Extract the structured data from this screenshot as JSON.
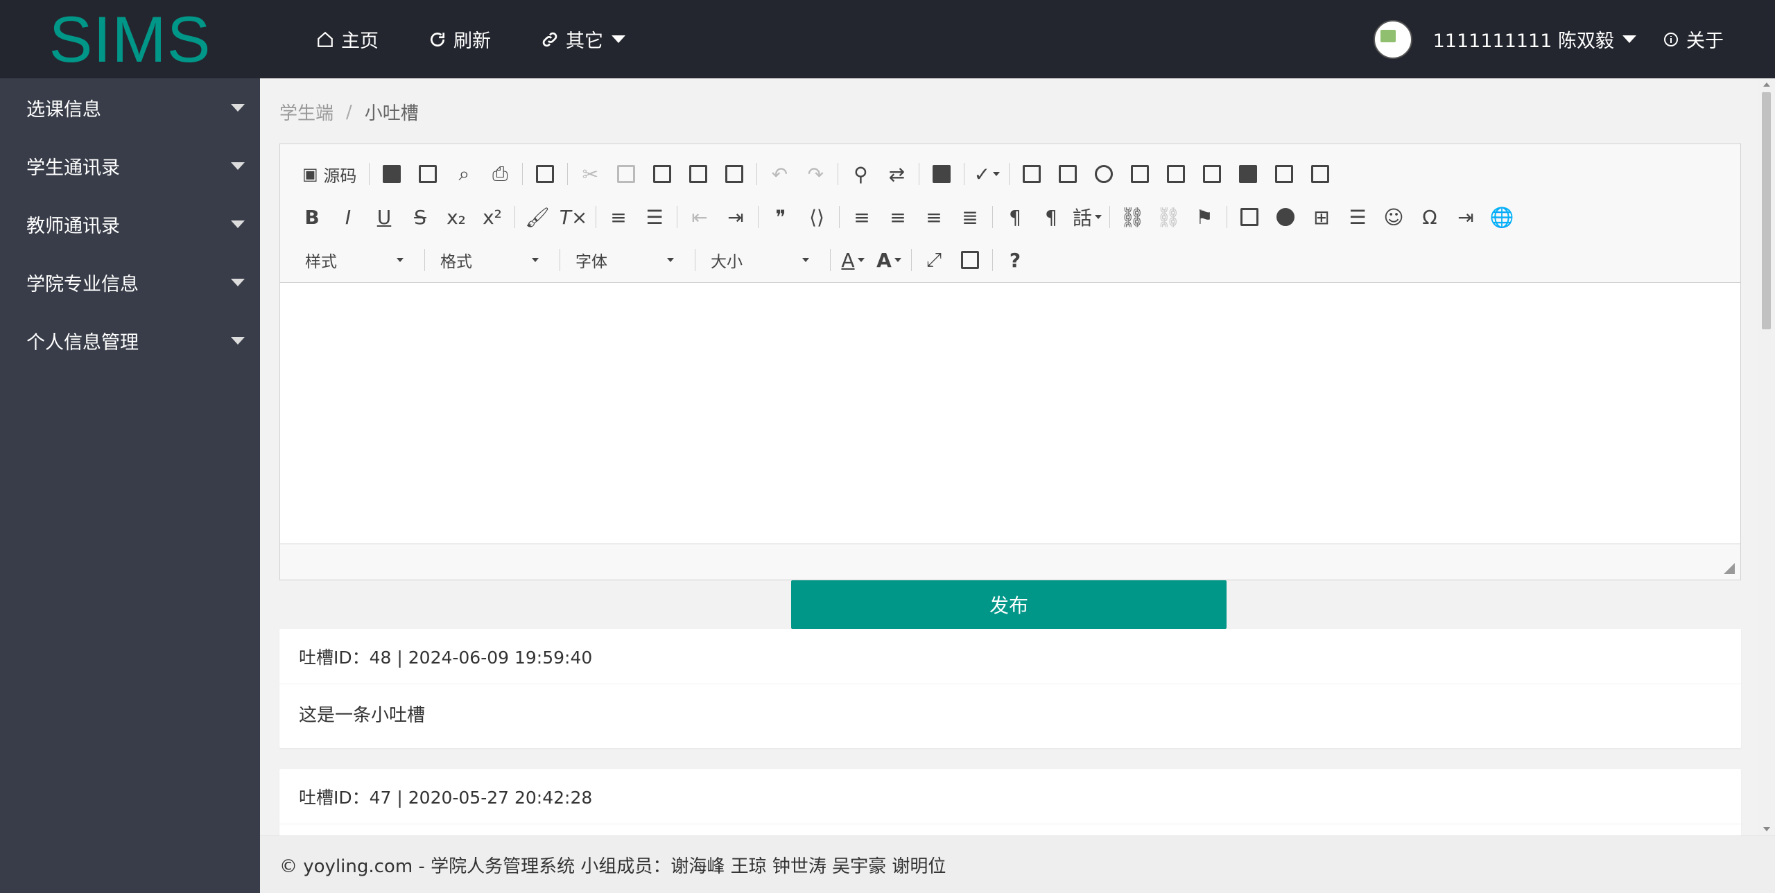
{
  "header": {
    "logo": "SIMS",
    "nav": [
      {
        "label": "主页",
        "icon": "home-icon"
      },
      {
        "label": "刷新",
        "icon": "refresh-icon"
      },
      {
        "label": "其它",
        "icon": "link-icon"
      }
    ],
    "user": "1111111111 陈双毅",
    "about": "关于"
  },
  "sidebar": {
    "items": [
      {
        "label": "选课信息"
      },
      {
        "label": "学生通讯录"
      },
      {
        "label": "教师通讯录"
      },
      {
        "label": "学院专业信息"
      },
      {
        "label": "个人信息管理"
      }
    ]
  },
  "breadcrumb": {
    "root": "学生端",
    "separator": "/",
    "current": "小吐槽"
  },
  "editor": {
    "source_label": "源码",
    "combos": [
      "样式",
      "格式",
      "字体",
      "大小"
    ]
  },
  "publish_label": "发布",
  "posts": [
    {
      "head": "吐槽ID：48 | 2024-06-09 19:59:40",
      "body": "这是一条小吐槽"
    },
    {
      "head": "吐槽ID：47 | 2020-05-27 20:42:28",
      "body": ""
    }
  ],
  "footer": "© yoyling.com - 学院人务管理系统 小组成员：谢海峰 王琼 钟世涛 吴宇豪 谢明位",
  "colors": {
    "header_bg": "#23262e",
    "sidebar_bg": "#393d49",
    "accent": "#009688"
  }
}
